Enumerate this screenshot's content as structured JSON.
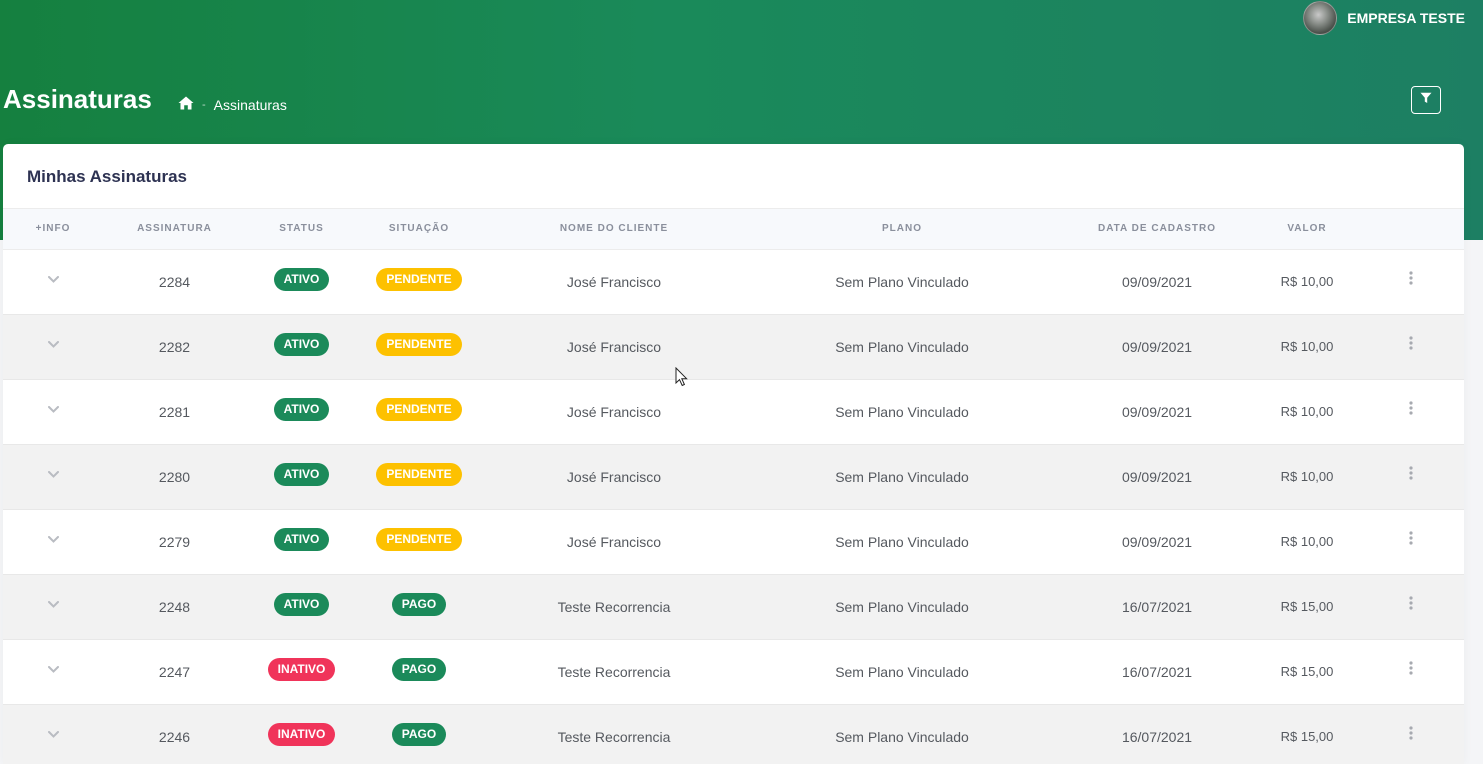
{
  "header": {
    "user_name": "EMPRESA TESTE",
    "page_title": "Assinaturas",
    "breadcrumb_current": "Assinaturas"
  },
  "card": {
    "title": "Minhas Assinaturas"
  },
  "table": {
    "columns": [
      "+INFO",
      "ASSINATURA",
      "STATUS",
      "SITUAÇÃO",
      "NOME DO CLIENTE",
      "PLANO",
      "DATA DE CADASTRO",
      "VALOR"
    ],
    "rows": [
      {
        "assinatura": "2284",
        "status": "ATIVO",
        "situacao": "PENDENTE",
        "cliente": "José Francisco",
        "plano": "Sem Plano Vinculado",
        "data": "09/09/2021",
        "valor": "R$ 10,00"
      },
      {
        "assinatura": "2282",
        "status": "ATIVO",
        "situacao": "PENDENTE",
        "cliente": "José Francisco",
        "plano": "Sem Plano Vinculado",
        "data": "09/09/2021",
        "valor": "R$ 10,00"
      },
      {
        "assinatura": "2281",
        "status": "ATIVO",
        "situacao": "PENDENTE",
        "cliente": "José Francisco",
        "plano": "Sem Plano Vinculado",
        "data": "09/09/2021",
        "valor": "R$ 10,00"
      },
      {
        "assinatura": "2280",
        "status": "ATIVO",
        "situacao": "PENDENTE",
        "cliente": "José Francisco",
        "plano": "Sem Plano Vinculado",
        "data": "09/09/2021",
        "valor": "R$ 10,00"
      },
      {
        "assinatura": "2279",
        "status": "ATIVO",
        "situacao": "PENDENTE",
        "cliente": "José Francisco",
        "plano": "Sem Plano Vinculado",
        "data": "09/09/2021",
        "valor": "R$ 10,00"
      },
      {
        "assinatura": "2248",
        "status": "ATIVO",
        "situacao": "PAGO",
        "cliente": "Teste Recorrencia",
        "plano": "Sem Plano Vinculado",
        "data": "16/07/2021",
        "valor": "R$ 15,00"
      },
      {
        "assinatura": "2247",
        "status": "INATIVO",
        "situacao": "PAGO",
        "cliente": "Teste Recorrencia",
        "plano": "Sem Plano Vinculado",
        "data": "16/07/2021",
        "valor": "R$ 15,00"
      },
      {
        "assinatura": "2246",
        "status": "INATIVO",
        "situacao": "PAGO",
        "cliente": "Teste Recorrencia",
        "plano": "Sem Plano Vinculado",
        "data": "16/07/2021",
        "valor": "R$ 15,00"
      }
    ]
  },
  "colors": {
    "ATIVO": "#1b8a5a",
    "INATIVO": "#f0345a",
    "PENDENTE": "#fdc100",
    "PAGO": "#1b8a5a"
  },
  "icons": {
    "home": "home-icon",
    "filter": "filter-icon",
    "expand": "chevron-down-icon",
    "actions": "kebab-menu-icon"
  }
}
